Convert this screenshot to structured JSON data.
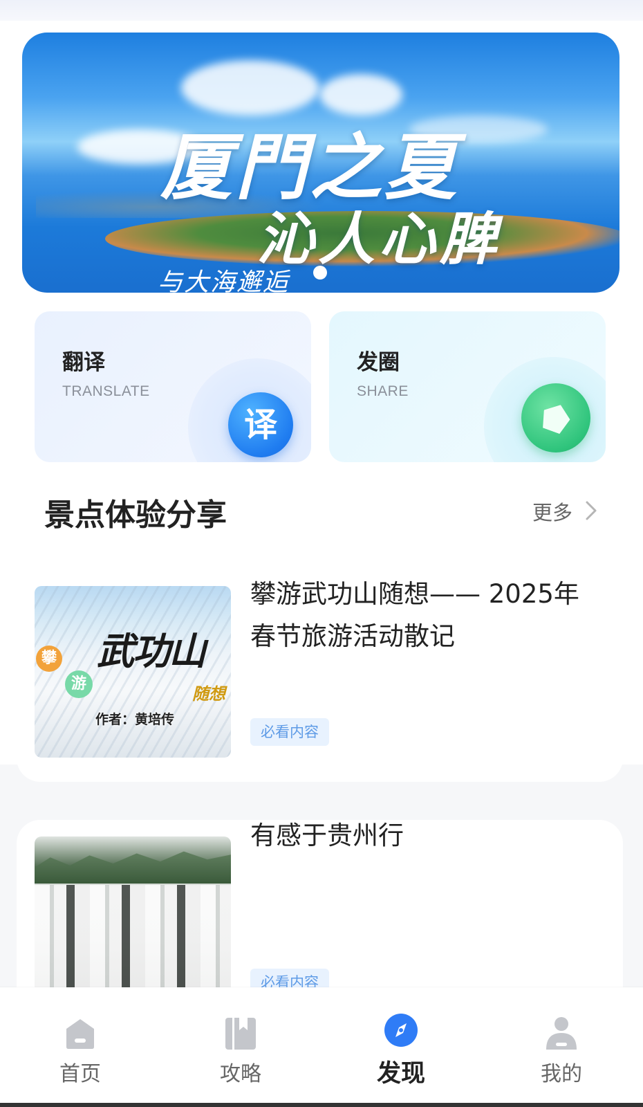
{
  "banner": {
    "title_line1": "厦門之夏",
    "title_line2": "沁人心脾",
    "title_line3": "与大海邂逅"
  },
  "features": [
    {
      "title": "翻译",
      "subtitle": "TRANSLATE",
      "icon_text": "译",
      "icon": "translate-icon"
    },
    {
      "title": "发圈",
      "subtitle": "SHARE",
      "icon": "camera-aperture-icon"
    }
  ],
  "section": {
    "title": "景点体验分享",
    "more_label": "更多"
  },
  "articles": [
    {
      "title": "攀游武功山随想—— 2025年春节旅游活动散记",
      "tag": "必看内容",
      "thumb": {
        "badge1": "攀",
        "badge2": "游",
        "title": "武功山",
        "subtitle": "随想",
        "author": "作者：黄培传"
      }
    },
    {
      "title": "有感于贵州行",
      "tag": "必看内容"
    }
  ],
  "nav": [
    {
      "label": "首页",
      "icon": "home-icon",
      "active": false
    },
    {
      "label": "攻略",
      "icon": "guide-book-icon",
      "active": false
    },
    {
      "label": "发现",
      "icon": "compass-icon",
      "active": true
    },
    {
      "label": "我的",
      "icon": "user-icon",
      "active": false
    }
  ],
  "colors": {
    "accent": "#2f7cf6",
    "tag_bg": "#e8f2fe",
    "tag_text": "#5e9be6",
    "share_green": "#2fc47c"
  }
}
